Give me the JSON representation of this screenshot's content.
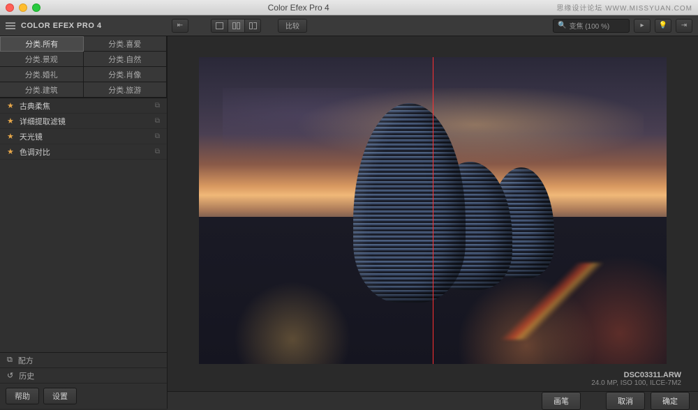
{
  "titlebar": {
    "title": "Color Efex Pro 4",
    "watermark": "思缘设计论坛  WWW.MISSYUAN.COM"
  },
  "brand": "COLOR EFEX PRO 4",
  "toolbar": {
    "compare_label": "比较",
    "search": "变焦 (100 %)"
  },
  "categories": [
    {
      "label": "分类.所有",
      "selected": true
    },
    {
      "label": "分类.喜爱"
    },
    {
      "label": "分类.景观"
    },
    {
      "label": "分类.自然"
    },
    {
      "label": "分类.婚礼"
    },
    {
      "label": "分类.肖像"
    },
    {
      "label": "分类.建筑"
    },
    {
      "label": "分类.旅游"
    }
  ],
  "filters": [
    {
      "label": "古典柔焦",
      "starred": true
    },
    {
      "label": "详细提取滤镜",
      "starred": true
    },
    {
      "label": "天光镜",
      "starred": true
    },
    {
      "label": "色调对比",
      "starred": true
    }
  ],
  "sidebar_bottom": {
    "recipe": "配方",
    "history": "历史",
    "help": "帮助",
    "settings": "设置"
  },
  "footer": {
    "brush": "画笔",
    "cancel": "取消",
    "ok": "确定"
  },
  "file": {
    "name": "DSC03311.ARW",
    "meta": "24.0 MP, ISO 100, ILCE-7M2"
  }
}
